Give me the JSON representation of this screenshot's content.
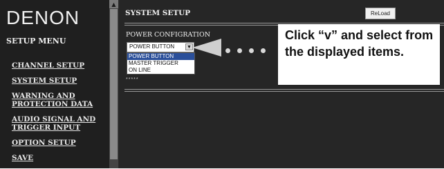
{
  "brand": "DENON",
  "sidebar": {
    "heading": "SETUP MENU",
    "items": [
      {
        "label": "CHANNEL SETUP"
      },
      {
        "label": "SYSTEM SETUP"
      },
      {
        "label": "WARNING AND PROTECTION DATA"
      },
      {
        "label": "AUDIO SIGNAL AND TRIGGER INPUT"
      },
      {
        "label": "OPTION SETUP"
      },
      {
        "label": "SAVE"
      }
    ]
  },
  "main": {
    "title": "SYSTEM SETUP",
    "reload_label": "ReLoad",
    "section_label": "POWER CONFIGRATION",
    "select": {
      "value": "POWER BUTTON",
      "options": [
        "POWER BUTTON",
        "MASTER TRIGGER",
        "ON LINE"
      ]
    },
    "masked_value": "*****"
  },
  "callout": {
    "text": "Click “v” and select from the displayed items."
  },
  "colors": {
    "background": "#262626",
    "sidebar": "#1f1f1f",
    "selected_option": "#2a4f9a",
    "callout_bg": "#ffffff"
  }
}
